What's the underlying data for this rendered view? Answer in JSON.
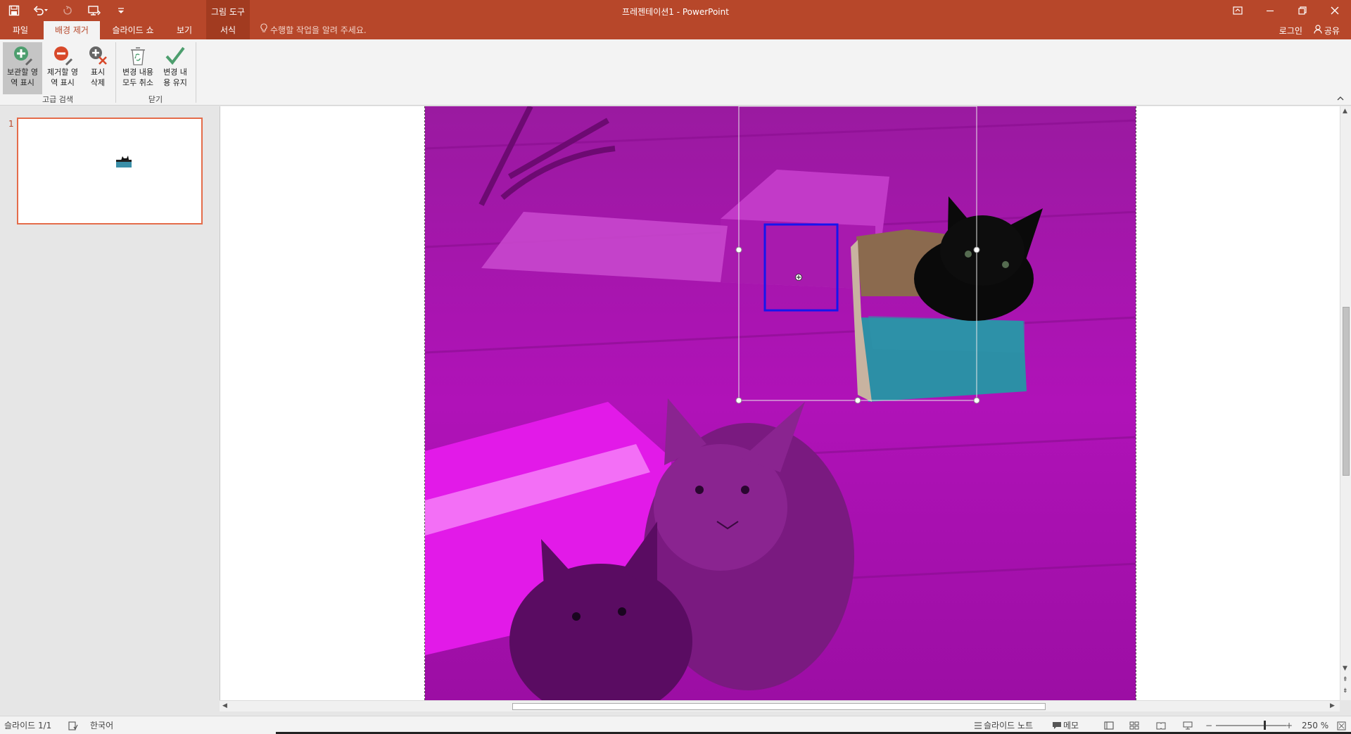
{
  "window": {
    "title": "프레젠테이션1 - PowerPoint",
    "contextual_group": "그림 도구"
  },
  "tabs": [
    {
      "label": "파일",
      "active": false
    },
    {
      "label": "배경 제거",
      "active": true
    },
    {
      "label": "슬라이드 쇼",
      "active": false
    },
    {
      "label": "보기",
      "active": false
    },
    {
      "label": "서식",
      "active": false,
      "contextual": true
    }
  ],
  "tellme": {
    "placeholder": "수행할 작업을 알려 주세요."
  },
  "account": {
    "login": "로그인",
    "share": "공유"
  },
  "ribbon": {
    "groups": [
      {
        "label": "고급 검색",
        "buttons": [
          {
            "label_1": "보관할 영",
            "label_2": "역 표시",
            "icon": "plus-icon",
            "selected": true
          },
          {
            "label_1": "제거할 영",
            "label_2": "역 표시",
            "icon": "minus-icon",
            "selected": false
          },
          {
            "label_1": "표시",
            "label_2": "삭제",
            "icon": "delete-mark-icon",
            "selected": false
          }
        ]
      },
      {
        "label": "닫기",
        "buttons": [
          {
            "label_1": "변경 내용",
            "label_2": "모두 취소",
            "icon": "recycle-bin-icon",
            "selected": false
          },
          {
            "label_1": "변경 내",
            "label_2": "용 유지",
            "icon": "checkmark-icon",
            "selected": false
          }
        ]
      }
    ]
  },
  "slides": [
    {
      "number": "1",
      "selected": true
    }
  ],
  "status": {
    "slide_counter": "슬라이드 1/1",
    "language": "한국어",
    "notes": "슬라이드 노트",
    "comments": "메모",
    "zoom": "250 %"
  },
  "colors": {
    "accent": "#b7472a",
    "remove_overlay": "#cc00cc",
    "marquee": "#1515ee"
  }
}
